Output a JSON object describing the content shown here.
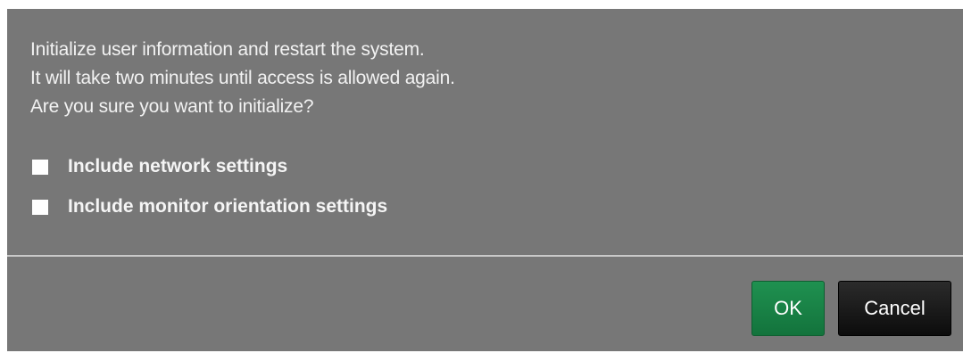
{
  "dialog": {
    "message_lines": [
      "Initialize user information and restart the system.",
      "It will take two minutes until access is allowed again.",
      "Are you sure you want to initialize?"
    ],
    "options": [
      {
        "label": "Include network settings",
        "checked": false
      },
      {
        "label": "Include monitor orientation settings",
        "checked": false
      }
    ],
    "buttons": {
      "ok_label": "OK",
      "cancel_label": "Cancel"
    }
  },
  "colors": {
    "dialog_background": "#777777",
    "ok_button": "#1a854a",
    "cancel_button": "#1a1a1a",
    "divider": "#c9c9c9"
  }
}
